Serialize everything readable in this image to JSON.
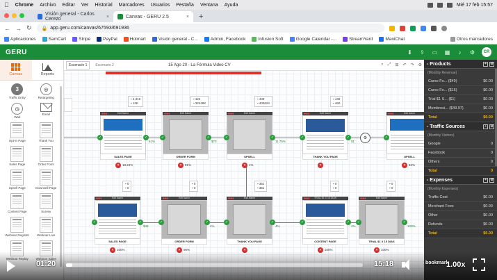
{
  "macbar": {
    "apple": "",
    "app": "Chrome",
    "menus": [
      "Archivo",
      "Editar",
      "Ver",
      "Historial",
      "Marcadores",
      "Usuarios",
      "Pestaña",
      "Ventana",
      "Ayuda"
    ],
    "clock": "Mié 17 feb 15:57"
  },
  "tabs": [
    {
      "label": "Visión general - Carlos Cerezo",
      "close": "×",
      "active": false,
      "color": "#2b6ad8"
    },
    {
      "label": "Canvas - GERU 2.5",
      "close": "×",
      "active": true,
      "color": "#1a8c3a"
    }
  ],
  "newtab": "+",
  "address": {
    "url": "app.geru.com/canvas/67593/691936",
    "back": "←",
    "forward": "→",
    "reload": "↻"
  },
  "bookmarks": [
    {
      "label": "Aplicaciones",
      "color": "#4285f4"
    },
    {
      "label": "SamCart",
      "color": "#2ca6e0"
    },
    {
      "label": "Stripe",
      "color": "#635bff"
    },
    {
      "label": "PayPal",
      "color": "#003087"
    },
    {
      "label": "Hotmart",
      "color": "#f04e23"
    },
    {
      "label": "Visión general - C...",
      "color": "#2b6ad8"
    },
    {
      "label": "Admin, Facebook",
      "color": "#1877f2"
    },
    {
      "label": "Infusion Soft",
      "color": "#5cb85c"
    },
    {
      "label": "Google Calendar -...",
      "color": "#4285f4"
    },
    {
      "label": "StreamYard",
      "color": "#7c3aed"
    },
    {
      "label": "ManiChat",
      "color": "#1a73e8"
    }
  ],
  "other_bookmarks": "Otros marcadores",
  "app": {
    "logo": "GERU",
    "avatar": "CR",
    "accent": "#1a8c3a"
  },
  "sidebar": {
    "tabs": [
      {
        "label": "Canvas"
      },
      {
        "label": "Reports"
      }
    ],
    "elements": [
      {
        "label": "Traffic Entry",
        "glyph": "3",
        "kind": "round"
      },
      {
        "label": "Retargeting",
        "glyph": "◎",
        "kind": "roundlight"
      },
      {
        "label": "Wait",
        "glyph": "◷",
        "kind": "roundlight"
      },
      {
        "label": "Email",
        "glyph": "",
        "kind": "env"
      },
      {
        "label": "Opt-in Page",
        "glyph": "",
        "kind": "page"
      },
      {
        "label": "Thank You",
        "glyph": "",
        "kind": "page"
      },
      {
        "label": "Sales Page",
        "glyph": "",
        "kind": "page"
      },
      {
        "label": "Order Form",
        "glyph": "",
        "kind": "page"
      },
      {
        "label": "Upsell Page",
        "glyph": "",
        "kind": "page"
      },
      {
        "label": "Downsell Page",
        "glyph": "",
        "kind": "page"
      },
      {
        "label": "Content Page",
        "glyph": "",
        "kind": "page"
      },
      {
        "label": "Survey",
        "glyph": "",
        "kind": "page"
      },
      {
        "label": "Webinar Register",
        "glyph": "",
        "kind": "page"
      },
      {
        "label": "Webinar Live",
        "glyph": "",
        "kind": "page"
      },
      {
        "label": "Webinar Replay",
        "glyph": "",
        "kind": "page"
      },
      {
        "label": "Webinar Sales",
        "glyph": "",
        "kind": "page"
      }
    ]
  },
  "canvas": {
    "scenarios": [
      "Escenario 1",
      "Escenario 2"
    ],
    "title": "15 Ago 20 - La Fórmula Video CV",
    "tool_icons": [
      "⌕",
      "⤢",
      "⊞",
      "↶",
      "↷",
      "⚙"
    ],
    "top_row": [
      {
        "bar": "Edit Name",
        "label": "SALES PAGE",
        "stats": [
          "4,316",
          "13K"
        ],
        "rate": "18.24%",
        "thumb": "blue"
      },
      {
        "bar": "Edit Name",
        "label": "ORDER FORM",
        "stats": [
          "124",
          "32448K"
        ],
        "rate": "91%",
        "thumb": "gray"
      },
      {
        "bar": "Edit Name",
        "label": "UPSELL",
        "stats": [
          "449",
          "403624"
        ],
        "rate": "1%",
        "thumb": "gray"
      },
      {
        "bar": "Edit Name",
        "label": "THANK YOU PAGE",
        "stats": [
          "449",
          "460"
        ],
        "rate": "",
        "thumb": "white"
      },
      {
        "bar": "Edit Name",
        "label": "UPSELL",
        "stats": [],
        "rate": "52%",
        "thumb": "blue"
      }
    ],
    "top_pcts": [
      "61%",
      "$70",
      "11.75%",
      "$1",
      "91%"
    ],
    "bottom_row": [
      {
        "bar": "Edit Name",
        "label": "SALES PAGE",
        "stats": [
          "0",
          "0"
        ],
        "rate": "100%",
        "thumb": "white"
      },
      {
        "bar": "Edit Name",
        "label": "ORDER FORM",
        "stats": [
          "0",
          "0"
        ],
        "rate": "96%",
        "thumb": "gray"
      },
      {
        "bar": "Edit Name",
        "label": "THANK YOU PAGE",
        "stats": [
          "351",
          "351"
        ],
        "rate": "",
        "thumb": "gray"
      },
      {
        "bar": "TRIAL $1 X 15 DIAS",
        "label": "CONTENT PAGE",
        "stats": [
          "0",
          "0"
        ],
        "rate": "100%",
        "thumb": "white"
      },
      {
        "bar": "Edit Name",
        "label": "TRIAL $1 X 15 DIAS",
        "stats": [
          "0",
          "0"
        ],
        "rate": "100%",
        "thumb": "gray"
      }
    ],
    "bottom_pcts": [
      "$49",
      "4%",
      "4%",
      "4%",
      "100%"
    ]
  },
  "panel": {
    "sections": [
      {
        "title": "Products",
        "sub": "(Monthly Revenue)",
        "rows": [
          {
            "name": "Curso Fo... ($49)",
            "value": "$0.00"
          },
          {
            "name": "Curso Fo... ($15)",
            "value": "$0.00"
          },
          {
            "name": "Trial $1 S... ($1)",
            "value": "$0.00"
          },
          {
            "name": "Membresi... ($49.97)",
            "value": "$0.00"
          }
        ],
        "total": {
          "name": "Total",
          "value": "$0.00"
        }
      },
      {
        "title": "Traffic Sources",
        "sub": "(Monthly Visitors)",
        "rows": [
          {
            "name": "Google",
            "value": "0"
          },
          {
            "name": "Facebook",
            "value": "0"
          },
          {
            "name": "Others",
            "value": "0"
          }
        ],
        "total": {
          "name": "Total",
          "value": "0"
        }
      },
      {
        "title": "Expenses",
        "sub": "(Monthly Expenses)",
        "rows": [
          {
            "name": "Traffic Cost",
            "value": "$0.00"
          },
          {
            "name": "Merchant Fees",
            "value": "$0.00"
          },
          {
            "name": "Other",
            "value": "$0.00"
          },
          {
            "name": "Refunds",
            "value": "$0.00"
          }
        ],
        "total": {
          "name": "Total",
          "value": "$0.00"
        }
      }
    ]
  },
  "video": {
    "current": "01:20",
    "duration": "15:18",
    "progress_fraction": 0.02,
    "bookmark": "bookmark",
    "speed": "1.00x"
  }
}
